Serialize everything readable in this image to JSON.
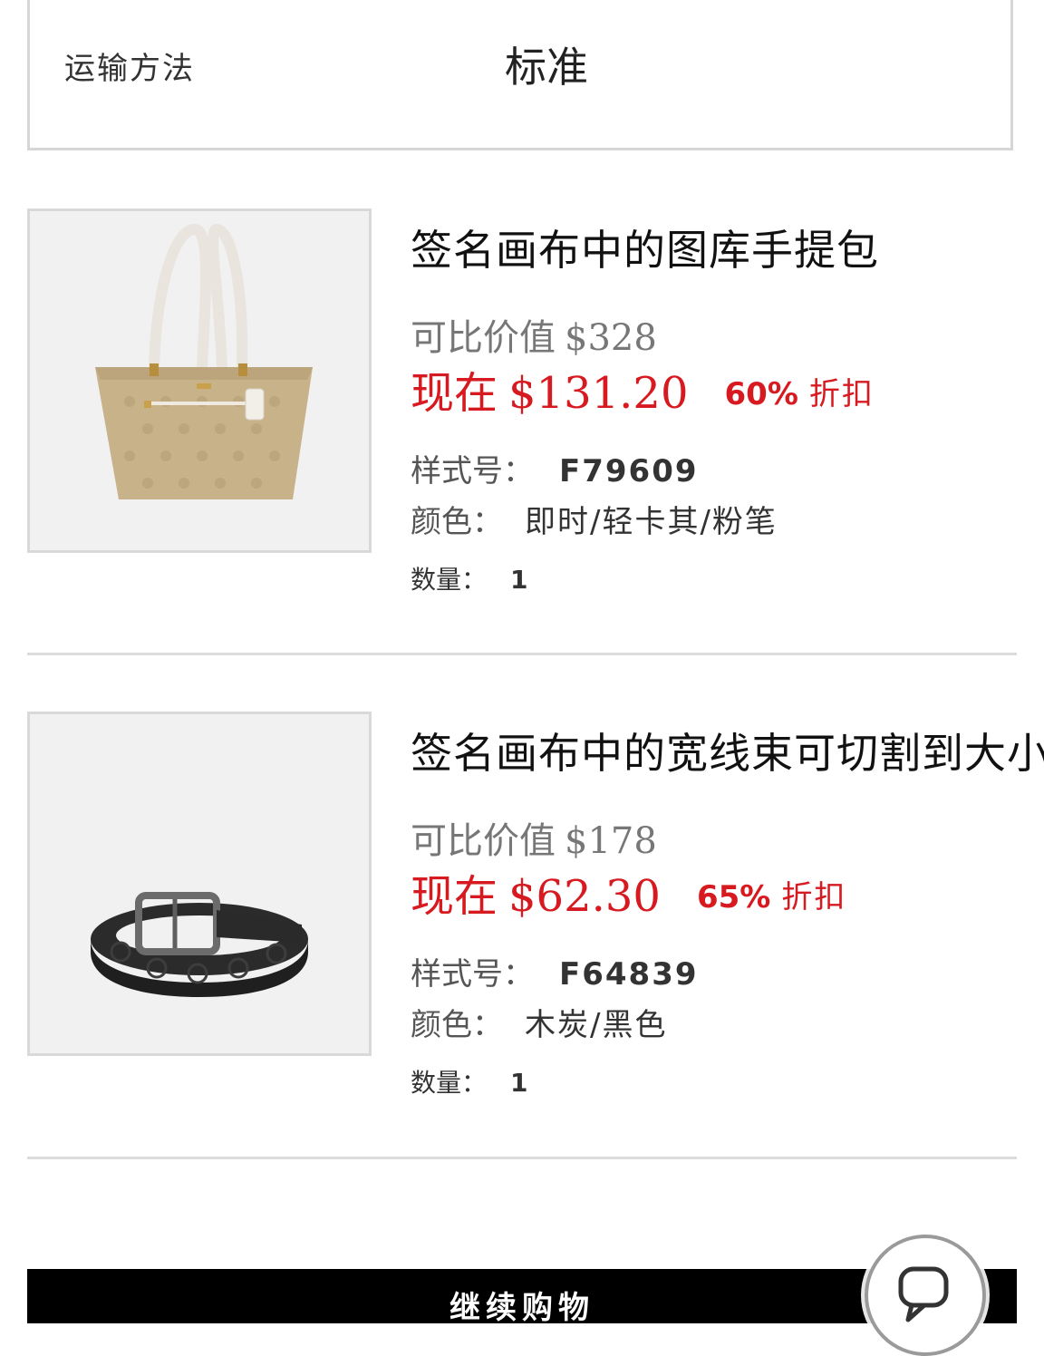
{
  "shipping": {
    "label": "运输方法",
    "value": "标准"
  },
  "products": [
    {
      "title": "签名画布中的图库手提包",
      "compare_label": "可比价值",
      "compare_price": "$328",
      "now_label": "现在",
      "now_price": "$131.20",
      "discount": "60%",
      "discount_word": "折扣",
      "style_label": "样式号：",
      "style_value": "F79609",
      "color_label": "颜色：",
      "color_value": "即时/轻卡其/粉笔",
      "qty_label": "数量：",
      "qty_value": "1",
      "image_icon": "tote-bag-image"
    },
    {
      "title": "签名画布中的宽线束可切割到大小",
      "compare_label": "可比价值",
      "compare_price": "$178",
      "now_label": "现在",
      "now_price": "$62.30",
      "discount": "65%",
      "discount_word": "折扣",
      "style_label": "样式号：",
      "style_value": "F64839",
      "color_label": "颜色：",
      "color_value": "木炭/黑色",
      "qty_label": "数量：",
      "qty_value": "1",
      "image_icon": "belt-image"
    }
  ],
  "checkout": {
    "label": "继续购物"
  },
  "colors": {
    "sale_red": "#d71920",
    "muted_gray": "#777777",
    "bar_black": "#000000"
  },
  "chat": {
    "icon": "chat-icon"
  }
}
